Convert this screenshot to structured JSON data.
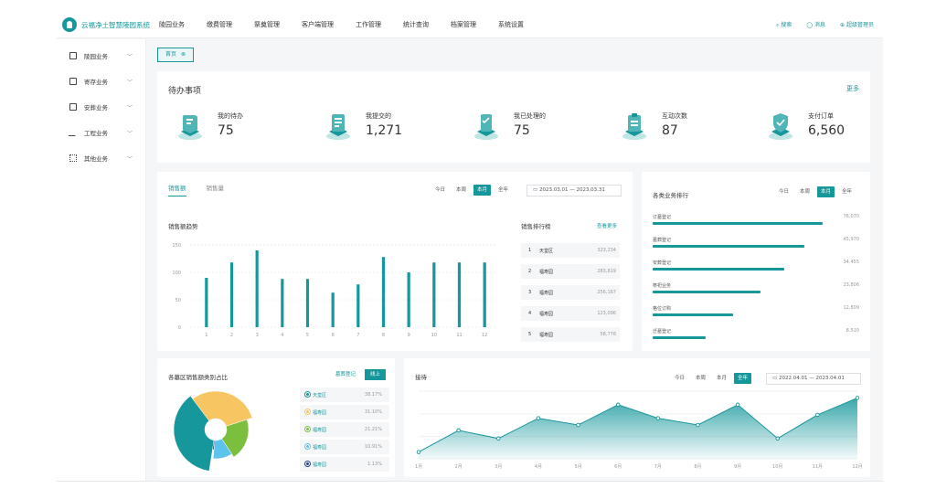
{
  "app": {
    "brand": "云福净土智慧陵园系统",
    "nav": [
      "陵园业务",
      "缴费管理",
      "祭奠管理",
      "客户端管理",
      "工作管理",
      "统计查询",
      "档案管理",
      "系统设置"
    ],
    "top_right": {
      "search": "搜索",
      "message": "消息",
      "admin": "超级管理员"
    }
  },
  "sidebar": {
    "items": [
      {
        "label": "陵园业务"
      },
      {
        "label": "寄存业务"
      },
      {
        "label": "安葬业务"
      },
      {
        "label": "工程业务"
      },
      {
        "label": "其他业务"
      }
    ]
  },
  "tabs": {
    "home": "首页",
    "close": "⊗"
  },
  "todo": {
    "title": "待办事项",
    "more": "更多",
    "items": [
      {
        "label": "我的待办",
        "value": "75"
      },
      {
        "label": "我提交的",
        "value": "1,271"
      },
      {
        "label": "我已处理的",
        "value": "75"
      },
      {
        "label": "互动次数",
        "value": "87"
      },
      {
        "label": "支付订单",
        "value": "6,560"
      }
    ]
  },
  "sales": {
    "tabs": [
      "销售额",
      "销售量"
    ],
    "range_options": [
      "今日",
      "本周",
      "本月",
      "全年"
    ],
    "range_selected": "本月",
    "date_range": "2023.03.01 — 2023.03.31",
    "trend_title": "销售额趋势",
    "rank_title": "销售排行榜",
    "rank_more": "查看更多",
    "ranking": [
      {
        "rank": "1",
        "name": "天堂区",
        "value": "323,234"
      },
      {
        "rank": "2",
        "name": "福寿园",
        "value": "283,819"
      },
      {
        "rank": "3",
        "name": "福寿园",
        "value": "256,167"
      },
      {
        "rank": "4",
        "name": "福寿园",
        "value": "123,096"
      },
      {
        "rank": "5",
        "name": "福寿园",
        "value": "58,776"
      }
    ]
  },
  "biz": {
    "title": "各类业务排行",
    "range_options": [
      "今日",
      "本周",
      "本月",
      "全年"
    ],
    "range_selected": "本月",
    "rows": [
      {
        "label": "订墓登记",
        "value": "76,070",
        "fraction": 0.93
      },
      {
        "label": "墓葬登记",
        "value": "45,970",
        "fraction": 0.83
      },
      {
        "label": "安葬登记",
        "value": "34,455",
        "fraction": 0.72
      },
      {
        "label": "祭祀业务",
        "value": "23,806",
        "fraction": 0.59
      },
      {
        "label": "格位订购",
        "value": "12,809",
        "fraction": 0.44
      },
      {
        "label": "迁墓登记",
        "value": "8,510",
        "fraction": 0.29
      }
    ]
  },
  "pie": {
    "title": "各墓区销售额类别占比",
    "buttons": [
      "墓葬登记",
      "线上"
    ],
    "selected": "线上",
    "legend": [
      {
        "label": "天堂区",
        "value": "38.17%",
        "color": "#16979b"
      },
      {
        "label": "福寿园",
        "value": "31.10%",
        "color": "#f7c561"
      },
      {
        "label": "福寿园",
        "value": "21.21%",
        "color": "#7cbf3f"
      },
      {
        "label": "福寿园",
        "value": "10.91%",
        "color": "#5ec3ec"
      },
      {
        "label": "福寿园",
        "value": "1.13%",
        "color": "#1d3f8f"
      }
    ]
  },
  "reception": {
    "title": "接待",
    "range_options": [
      "今日",
      "本周",
      "本月",
      "全年"
    ],
    "range_selected": "全年",
    "date_range": "2022.04.01 — 2023.04.01"
  },
  "chart_data": [
    {
      "type": "bar",
      "title": "销售额趋势",
      "categories": [
        "1",
        "2",
        "3",
        "4",
        "5",
        "6",
        "7",
        "8",
        "9",
        "10",
        "11",
        "12"
      ],
      "values": [
        90,
        118,
        140,
        88,
        88,
        63,
        78,
        128,
        100,
        118,
        118,
        118
      ],
      "ylim": [
        0,
        150
      ],
      "yticks": [
        0,
        50,
        100,
        150
      ],
      "color": "#16979b"
    },
    {
      "type": "pie",
      "title": "各墓区销售额类别占比",
      "categories": [
        "天堂区",
        "福寿园",
        "福寿园",
        "福寿园",
        "福寿园"
      ],
      "values": [
        38.17,
        31.1,
        21.21,
        10.91,
        1.13
      ],
      "colors": [
        "#16979b",
        "#f7c561",
        "#7cbf3f",
        "#5ec3ec",
        "#1d3f8f"
      ]
    },
    {
      "type": "area",
      "title": "接待",
      "categories": [
        "1月",
        "2月",
        "3月",
        "4月",
        "5月",
        "6月",
        "7月",
        "8月",
        "9月",
        "10月",
        "11月",
        "12月"
      ],
      "values": [
        10,
        42,
        30,
        60,
        50,
        80,
        60,
        50,
        80,
        30,
        65,
        90
      ],
      "ylim": [
        0,
        100
      ],
      "color": "#16979b"
    }
  ]
}
